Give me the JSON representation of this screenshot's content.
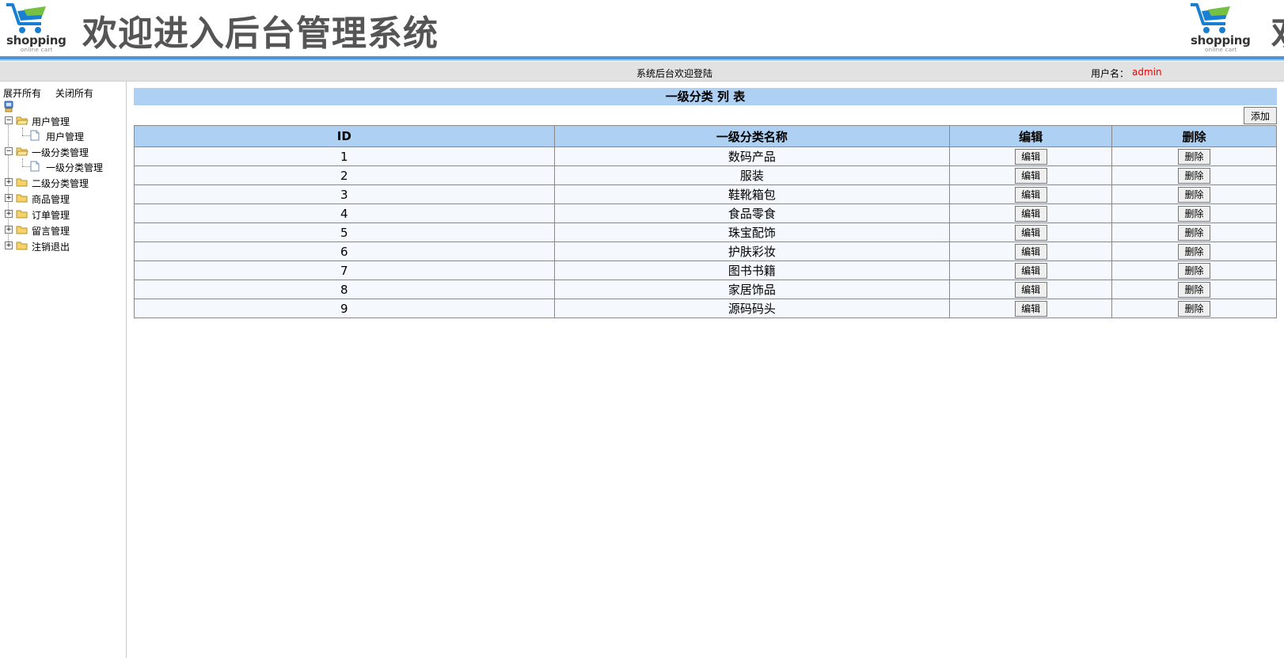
{
  "header": {
    "logo_brand": "shopping",
    "logo_sub": "online cart",
    "title": "欢迎进入后台管理系统",
    "title_clipped": "欢"
  },
  "welcome_bar": {
    "message": "系统后台欢迎登陆",
    "user_label": "用户名：",
    "user_name": "admin"
  },
  "sidebar": {
    "expand_all": "展开所有",
    "collapse_all": "关闭所有",
    "tree": [
      {
        "label": "用户管理",
        "expanded": true,
        "children": [
          "用户管理"
        ]
      },
      {
        "label": "一级分类管理",
        "expanded": true,
        "children": [
          "一级分类管理"
        ]
      },
      {
        "label": "二级分类管理",
        "expanded": false
      },
      {
        "label": "商品管理",
        "expanded": false
      },
      {
        "label": "订单管理",
        "expanded": false
      },
      {
        "label": "留言管理",
        "expanded": false
      },
      {
        "label": "注销退出",
        "expanded": false
      }
    ]
  },
  "main": {
    "title": "一级分类 列 表",
    "add_label": "添加",
    "columns": [
      "ID",
      "一级分类名称",
      "编辑",
      "删除"
    ],
    "edit_label": "编辑",
    "delete_label": "删除",
    "rows": [
      {
        "id": "1",
        "name": "数码产品"
      },
      {
        "id": "2",
        "name": "服装"
      },
      {
        "id": "3",
        "name": "鞋靴箱包"
      },
      {
        "id": "4",
        "name": "食品零食"
      },
      {
        "id": "5",
        "name": "珠宝配饰"
      },
      {
        "id": "6",
        "name": "护肤彩妆"
      },
      {
        "id": "7",
        "name": "图书书籍"
      },
      {
        "id": "8",
        "name": "家居饰品"
      },
      {
        "id": "9",
        "name": "源码码头"
      }
    ]
  },
  "colors": {
    "header_blue": "#4d95d8",
    "table_header": "#aed0f3",
    "username_red": "#ee0000"
  }
}
